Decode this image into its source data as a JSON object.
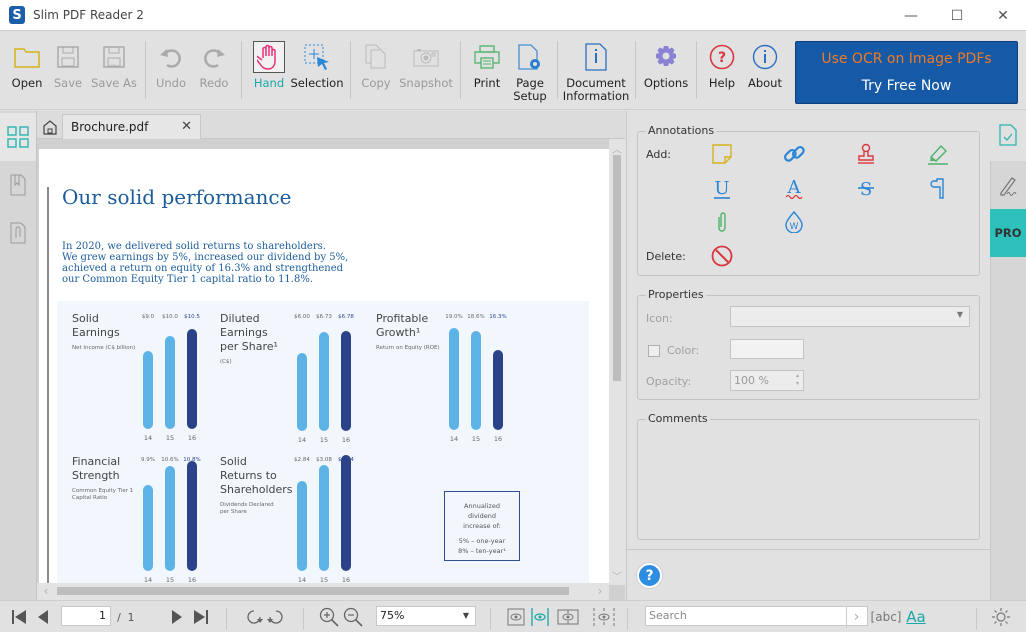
{
  "window": {
    "title": "Slim PDF Reader 2",
    "logo_letter": "S",
    "minimize": "—",
    "maximize": "☐",
    "close": "✕"
  },
  "toolbar": {
    "open": "Open",
    "save": "Save",
    "save_as": "Save As",
    "undo": "Undo",
    "redo": "Redo",
    "hand": "Hand",
    "selection": "Selection",
    "copy": "Copy",
    "snapshot": "Snapshot",
    "print": "Print",
    "page_setup_1": "Page",
    "page_setup_2": "Setup",
    "doc_info_1": "Document",
    "doc_info_2": "Information",
    "options": "Options",
    "help": "Help",
    "about": "About"
  },
  "promo": {
    "line1": "Use OCR on Image PDFs",
    "line2": "Try Free Now"
  },
  "tabs": {
    "document": "Brochure.pdf",
    "close": "✕"
  },
  "document": {
    "title": "Our solid performance",
    "intro": [
      "In 2020, we delivered solid returns to shareholders.",
      "We grew earnings by 5%, increased our dividend by 5%,",
      "achieved a return on equity of 16.3% and strengthened",
      "our Common Equity Tier 1 capital ratio to 11.8%."
    ],
    "metrics": [
      {
        "title": [
          "Solid",
          "Earnings"
        ],
        "subtitle": [
          "Net Income (C$ billion)"
        ],
        "years": [
          "14",
          "15",
          "16"
        ],
        "labels": [
          "$9.0",
          "$10.0",
          "$10.5"
        ],
        "values": [
          9.0,
          10.0,
          10.5
        ]
      },
      {
        "title": [
          "Diluted",
          "Earnings",
          "per Share¹"
        ],
        "subtitle": [
          "(C$)"
        ],
        "years": [
          "14",
          "15",
          "16"
        ],
        "labels": [
          "$6.00",
          "$6.73",
          "$6.78"
        ],
        "values": [
          6.0,
          6.73,
          6.78
        ]
      },
      {
        "title": [
          "Profitable",
          "Growth¹"
        ],
        "subtitle": [
          "Return on Equity (ROE)"
        ],
        "years": [
          "14",
          "15",
          "16"
        ],
        "labels": [
          "19.0%",
          "18.6%",
          "16.3%"
        ],
        "values": [
          19.0,
          18.6,
          16.3
        ]
      },
      {
        "title": [
          "Financial",
          "Strength"
        ],
        "subtitle": [
          "Common Equity Tier 1",
          "Capital Ratio"
        ],
        "years": [
          "14",
          "15",
          "16"
        ],
        "labels": [
          "9.9%",
          "10.6%",
          "10.8%"
        ],
        "values": [
          9.9,
          10.6,
          10.8
        ]
      },
      {
        "title": [
          "Solid",
          "Returns to",
          "Shareholders"
        ],
        "subtitle": [
          "Dividends Declared",
          "per Share"
        ],
        "years": [
          "14",
          "15",
          "16"
        ],
        "labels": [
          "$2.84",
          "$3.08",
          "$3.24"
        ],
        "values": [
          2.84,
          3.08,
          3.24
        ]
      }
    ],
    "note": [
      "Annualized",
      "dividend",
      "increase of:",
      "",
      "5% – one-year",
      "8% – ten-year¹"
    ],
    "colors": {
      "bar_light": "#5eb3e6",
      "bar_dark": "#2b4188",
      "title": "#1b5d9b"
    }
  },
  "annotations": {
    "title": "Annotations",
    "add_label": "Add:",
    "delete_label": "Delete:",
    "tools": [
      "note-icon",
      "link-icon",
      "stamp-icon",
      "highlight-icon",
      "underline-icon",
      "squiggly-icon",
      "strikeout-icon",
      "callout-icon",
      "attachment-icon",
      "watermark-icon"
    ]
  },
  "properties": {
    "title": "Properties",
    "icon_label": "Icon:",
    "icon_value": "",
    "color_label": "Color:",
    "opacity_label": "Opacity:",
    "opacity_value": "100 %"
  },
  "comments": {
    "title": "Comments"
  },
  "right_tabs": {
    "pro": "PRO"
  },
  "statusbar": {
    "page_current": "1",
    "page_sep": "/",
    "page_total": "1",
    "zoom": "75%",
    "search_placeholder": "Search",
    "match_case": "Aa",
    "whole_word": "abc"
  }
}
